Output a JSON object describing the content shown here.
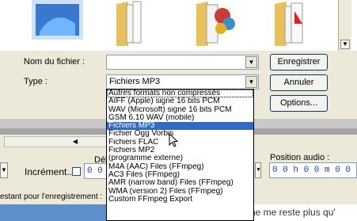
{
  "file_dialog": {
    "filename_label": "Nom du fichier :",
    "filename_value": "",
    "type_label": "Type :",
    "type_value": "Fichiers MP3",
    "save_button": "Enregistrer",
    "cancel_button": "Annuler",
    "options_button": "Options..."
  },
  "dropdown": {
    "selected_index": 4,
    "items": [
      "Autres formats non compressés",
      "AIFF (Apple) signé 16 bits PCM",
      "WAV (Microsoft) signé 16 bits PCM",
      "GSM 6.10 WAV (mobile)",
      "Fichiers MP3",
      "Fichier Ogg Vorbis",
      "Fichiers FLAC",
      "Fichiers MP2",
      "(programme externe)",
      "M4A (AAC) Files (FFmpeg)",
      "AC3 Files (FFmpeg)",
      "AMR (narrow band) Files (FFmpeg)",
      "WMA (version 2) Files (FFmpeg)",
      "Custom FFmpeg Export"
    ]
  },
  "app": {
    "debut_label": "Débu",
    "increment_label": "Incrément...",
    "increment_value": "0 0",
    "position_label": "Position audio :",
    "position_value": "0 0 h 0 0 m 0 0 s",
    "status_text": "estant pour l'enregistrement :",
    "background_text": "ne me reste plus qu'"
  }
}
